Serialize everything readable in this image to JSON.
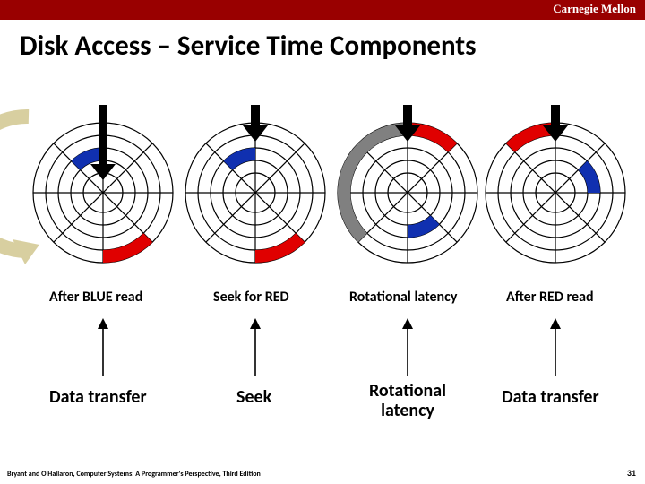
{
  "header": {
    "brand": "Carnegie Mellon"
  },
  "title": "Disk Access – Service Time Components",
  "labels": {
    "d1": "After BLUE read",
    "d2": "Seek for RED",
    "d3": "Rotational latency",
    "d4": "After RED read"
  },
  "bottom": {
    "b1": "Data transfer",
    "b2": "Seek",
    "b3": "Rotational\nlatency",
    "b4": "Data transfer"
  },
  "footer": "Bryant and O'Hallaron, Computer Systems: A Programmer's Perspective, Third Edition",
  "page": "31"
}
